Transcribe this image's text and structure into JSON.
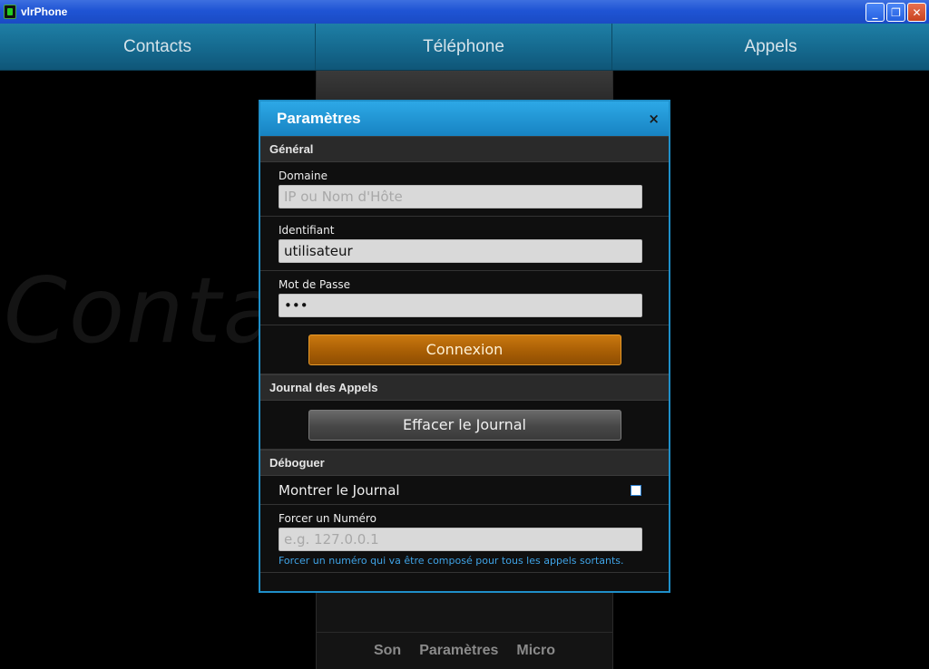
{
  "window": {
    "title": "vlrPhone",
    "minimize": "_",
    "restore": "❐",
    "close": "✕"
  },
  "tabs": [
    {
      "label": "Contacts"
    },
    {
      "label": "Téléphone"
    },
    {
      "label": "Appels"
    }
  ],
  "background": {
    "watermark": "Conta",
    "bottom_bar": [
      "Son",
      "Paramètres",
      "Micro"
    ]
  },
  "dialog": {
    "title": "Paramètres",
    "close": "×",
    "sections": {
      "general": {
        "title": "Général",
        "domain": {
          "label": "Domaine",
          "placeholder": "IP ou Nom d'Hôte",
          "value": ""
        },
        "identifier": {
          "label": "Identifiant",
          "value": "utilisateur"
        },
        "password": {
          "label": "Mot de Passe",
          "value": "•••"
        },
        "connect_button": "Connexion"
      },
      "call_log": {
        "title": "Journal des Appels",
        "clear_button": "Effacer le Journal"
      },
      "debug": {
        "title": "Déboguer",
        "show_log": {
          "label": "Montrer le Journal",
          "checked": false
        },
        "force_number": {
          "label": "Forcer un Numéro",
          "placeholder": "e.g. 127.0.0.1",
          "hint": "Forcer un numéro qui va être composé pour tous les appels sortants."
        }
      }
    }
  },
  "colors": {
    "accent": "#1f8fc9",
    "connect_button": "#a85e05",
    "tab_bar": "#15698e"
  }
}
